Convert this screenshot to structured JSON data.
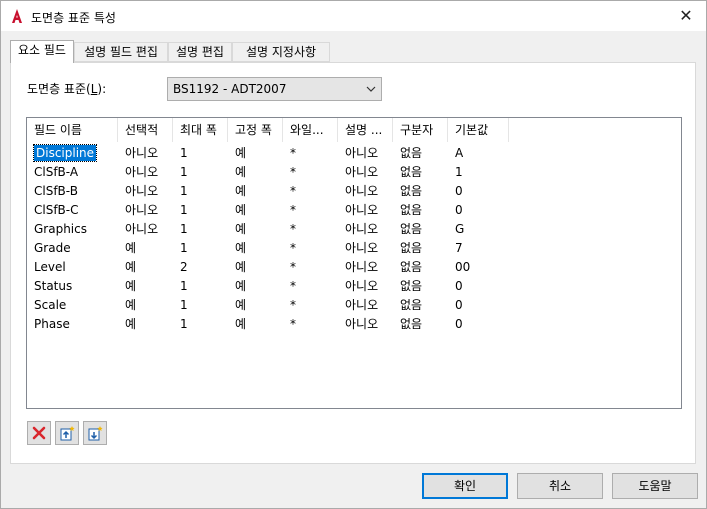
{
  "window": {
    "title": "도면층 표준 특성",
    "close": "✕"
  },
  "tabs": [
    {
      "label": "요소 필드"
    },
    {
      "label": "설명 필드 편집"
    },
    {
      "label": "설명 편집"
    },
    {
      "label": "설명 지정사항"
    }
  ],
  "standard": {
    "label_prefix": "도면층 표준(",
    "label_key": "L",
    "label_suffix": "):",
    "value": "BS1192 - ADT2007"
  },
  "table": {
    "columns": [
      "필드 이름",
      "선택적",
      "최대 폭",
      "고정 폭",
      "와일...",
      "설명 ...",
      "구분자",
      "기본값"
    ],
    "rows": [
      [
        "Discipline",
        "아니오",
        "1",
        "예",
        "*",
        "아니오",
        "없음",
        "A"
      ],
      [
        "ClSfB-A",
        "아니오",
        "1",
        "예",
        "*",
        "아니오",
        "없음",
        "1"
      ],
      [
        "ClSfB-B",
        "아니오",
        "1",
        "예",
        "*",
        "아니오",
        "없음",
        "0"
      ],
      [
        "ClSfB-C",
        "아니오",
        "1",
        "예",
        "*",
        "아니오",
        "없음",
        "0"
      ],
      [
        "Graphics",
        "아니오",
        "1",
        "예",
        "*",
        "아니오",
        "없음",
        "G"
      ],
      [
        "Grade",
        "예",
        "1",
        "예",
        "*",
        "아니오",
        "없음",
        "7"
      ],
      [
        "Level",
        "예",
        "2",
        "예",
        "*",
        "아니오",
        "없음",
        "00"
      ],
      [
        "Status",
        "예",
        "1",
        "예",
        "*",
        "아니오",
        "없음",
        "0"
      ],
      [
        "Scale",
        "예",
        "1",
        "예",
        "*",
        "아니오",
        "없음",
        "0"
      ],
      [
        "Phase",
        "예",
        "1",
        "예",
        "*",
        "아니오",
        "없음",
        "0"
      ]
    ]
  },
  "tools": [
    {
      "icon": "delete-x-icon"
    },
    {
      "icon": "insert-above-icon"
    },
    {
      "icon": "insert-below-icon"
    }
  ],
  "buttons": {
    "ok": "확인",
    "cancel": "취소",
    "help": "도움말"
  },
  "colors": {
    "accent": "#0078d7",
    "delete": "#d9262c",
    "app": "#c8102e"
  }
}
